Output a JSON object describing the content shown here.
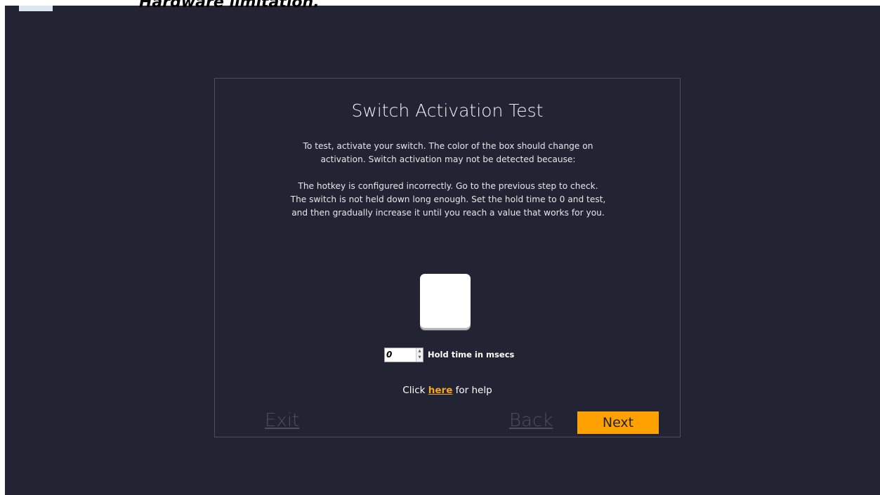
{
  "background_text": "Hardware limitation.",
  "card": {
    "title": "Switch Activation Test",
    "paragraph1": [
      "To test, activate your switch. The color of the box should change on",
      "activation. Switch activation may not be detected because:"
    ],
    "paragraph2": [
      "The hotkey is configured incorrectly. Go to the previous step to check.",
      "The switch is not held down long enough. Set the hold time to 0 and test,",
      "and then gradually increase it until you reach a value that works for you."
    ],
    "hold_time": {
      "value": "0",
      "label": "Hold time in msecs"
    },
    "help": {
      "prefix": "Click ",
      "link": "here",
      "suffix": " for help"
    },
    "exit_label": "Exit",
    "back_label": "Back",
    "next_label": "Next"
  },
  "colors": {
    "background": "#222433",
    "accent": "#ffa100",
    "link": "#f5a623",
    "muted_link": "#4b4e60",
    "test_box": "#ffffff"
  }
}
